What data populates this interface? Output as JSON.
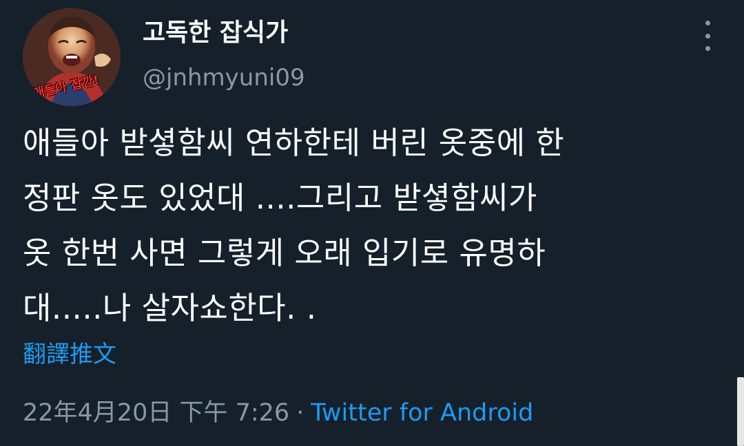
{
  "user": {
    "display_name": "고독한 잡식가",
    "handle": "@jnhmyuni09",
    "avatar_caption": "애들아 잡깐!"
  },
  "tweet": {
    "text": "애들아 받셯함씨 연하한테 버린 옷중에 한\n정판 옷도 있었대 ....그리고 받셯함씨가\n옷 한번 사면 그렇게 오래 입기로 유명하\n대.....나 살자쇼한다. .",
    "translate_label": "翻譯推文",
    "timestamp": "22年4月20日 下午 7:26",
    "separator": "·",
    "source": "Twitter for Android"
  },
  "icons": {
    "more": "more-vertical-icon"
  },
  "colors": {
    "background": "#15202b",
    "text": "#ffffff",
    "secondary": "#8899a6",
    "link": "#1d9bf0"
  }
}
